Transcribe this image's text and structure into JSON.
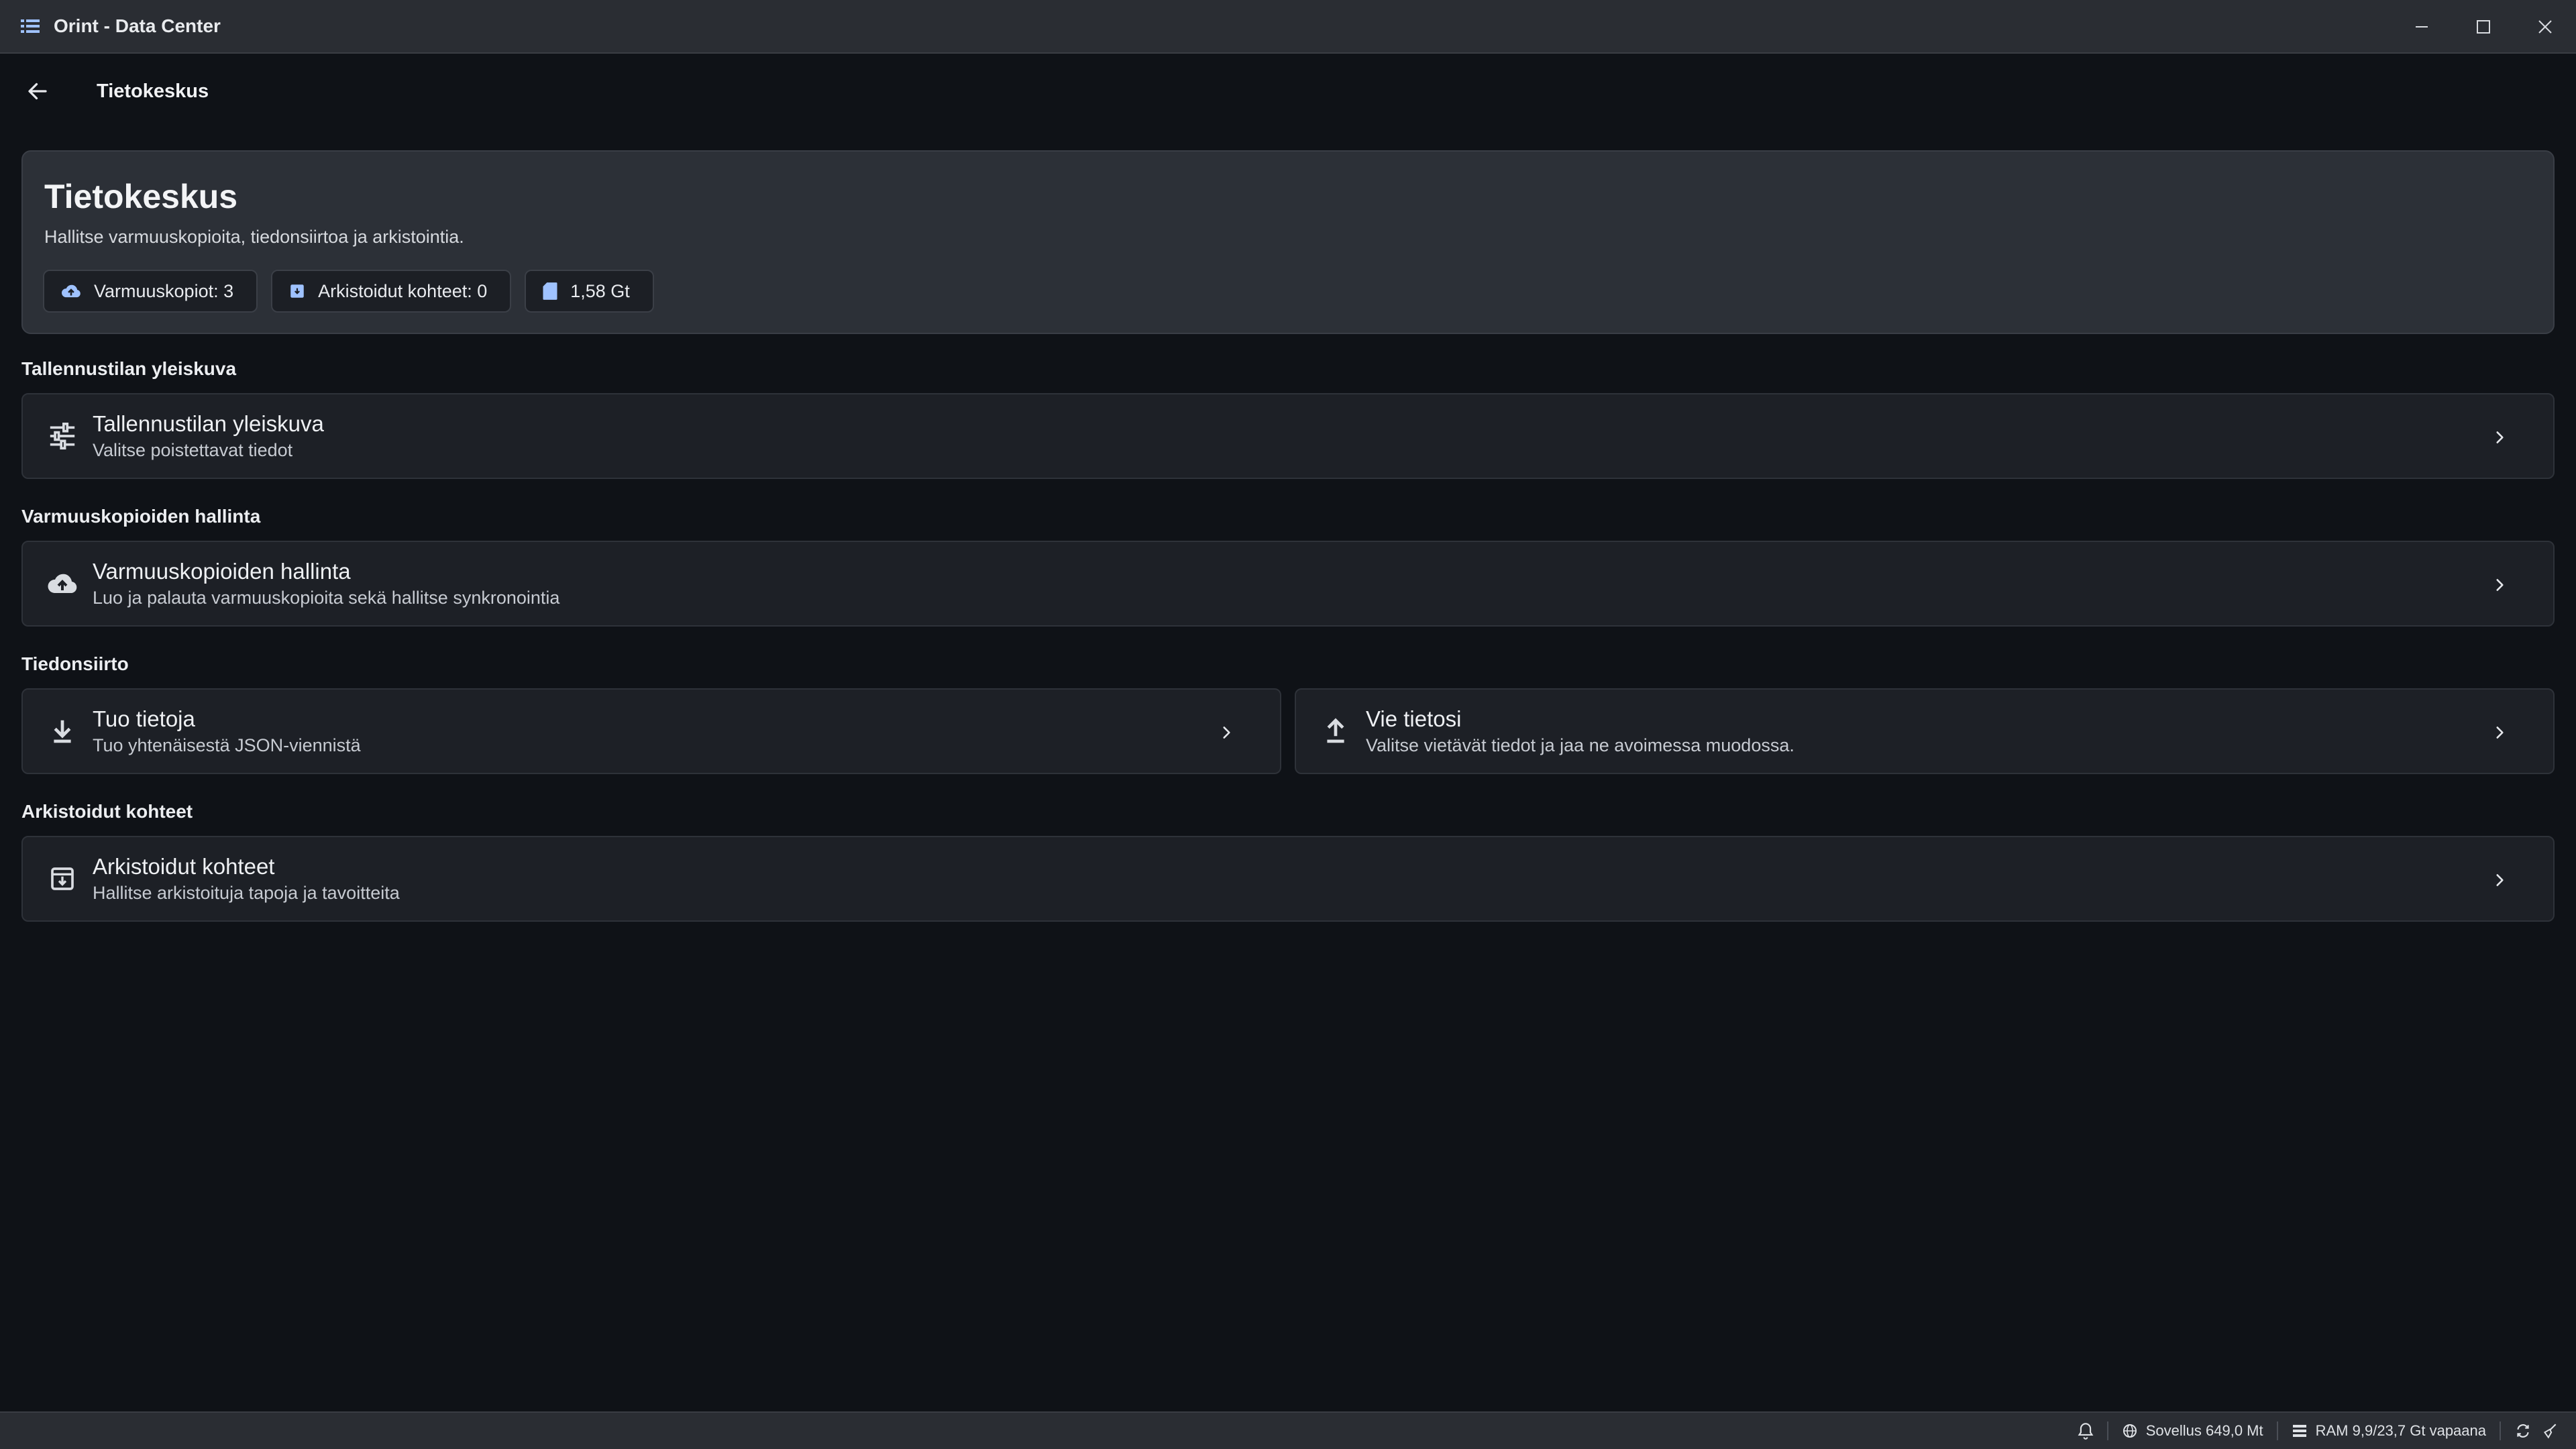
{
  "window": {
    "title": "Orint - Data Center",
    "controls": [
      "minimize",
      "maximize",
      "close"
    ]
  },
  "header": {
    "title": "Tietokeskus"
  },
  "hero": {
    "title": "Tietokeskus",
    "subtitle": "Hallitse varmuuskopioita, tiedonsiirtoa ja arkistointia.",
    "chips": [
      {
        "label": "Varmuuskopiot: 3",
        "icon": "cloud-upload-icon"
      },
      {
        "label": "Arkistoidut kohteet: 0",
        "icon": "archive-icon"
      },
      {
        "label": "1,58 Gt",
        "icon": "storage-icon"
      }
    ]
  },
  "sections": {
    "storage": {
      "label": "Tallennustilan yleiskuva",
      "card": {
        "title": "Tallennustilan yleiskuva",
        "subtitle": "Valitse poistettavat tiedot",
        "icon": "tune-icon"
      }
    },
    "backup": {
      "label": "Varmuuskopioiden hallinta",
      "card": {
        "title": "Varmuuskopioiden hallinta",
        "subtitle": "Luo ja palauta varmuuskopioita sekä hallitse synkronointia",
        "icon": "cloud-upload-icon"
      }
    },
    "transfer": {
      "label": "Tiedonsiirto",
      "import": {
        "title": "Tuo tietoja",
        "subtitle": "Tuo yhtenäisestä JSON-viennistä",
        "icon": "download-icon"
      },
      "export": {
        "title": "Vie tietosi",
        "subtitle": "Valitse vietävät tiedot ja jaa ne avoimessa muodossa.",
        "icon": "upload-icon"
      }
    },
    "archived": {
      "label": "Arkistoidut kohteet",
      "card": {
        "title": "Arkistoidut kohteet",
        "subtitle": "Hallitse arkistoituja tapoja ja tavoitteita",
        "icon": "archive-icon"
      }
    }
  },
  "statusbar": {
    "app_memory": "Sovellus 649,0 Mt",
    "ram": "RAM 9,9/23,7 Gt vapaana"
  },
  "colors": {
    "background": "#0f1217",
    "card": "#1d2026",
    "hero": "#2c3037",
    "titlebar": "#2a2d33",
    "accent": "#9fc2ff"
  }
}
